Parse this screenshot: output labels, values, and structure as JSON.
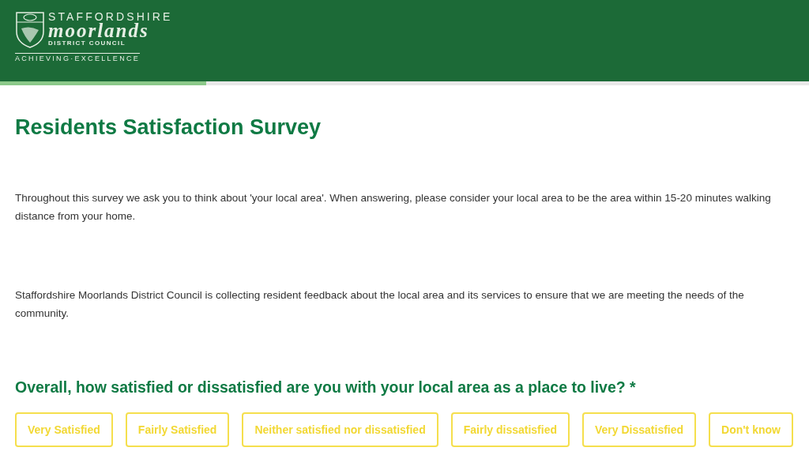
{
  "header": {
    "logo": {
      "line_1": "STAFFORDSHIRE",
      "line_2": "moorlands",
      "line_3": "DISTRICT COUNCIL",
      "tagline": "ACHIEVING·EXCELLENCE"
    }
  },
  "progress": {
    "level": 0.255
  },
  "title": "Residents Satisfaction Survey",
  "paragraphs": [
    "Throughout this survey we ask you to think about 'your local area'. When answering, please consider your local area to be the area within 15-20 minutes walking distance from your home.",
    "Staffordshire Moorlands District Council is collecting resident feedback about the local area and its services to ensure that we are meeting the needs of the community."
  ],
  "question": {
    "text": "Overall, how satisfied or dissatisfied are you with your local area as a place to live? *",
    "options": [
      {
        "label": "Very Satisfied",
        "selected": false
      },
      {
        "label": "Fairly Satisfied",
        "selected": false
      },
      {
        "label": "Neither satisfied nor dissatisfied",
        "selected": false
      },
      {
        "label": "Fairly dissatisfied",
        "selected": false
      },
      {
        "label": "Very Dissatisfied",
        "selected": false
      },
      {
        "label": "Don't know",
        "selected": false
      }
    ]
  }
}
